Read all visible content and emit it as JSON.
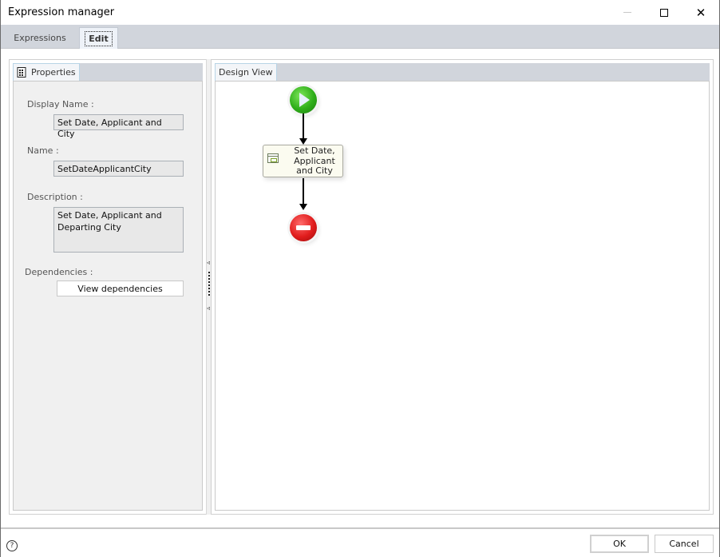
{
  "window": {
    "title": "Expression manager",
    "controls": {
      "minimize": "minimize-icon",
      "maximize": "maximize-icon",
      "close": "close-icon",
      "close_glyph": "✕"
    }
  },
  "tabs": [
    {
      "label": "Expressions",
      "active": false
    },
    {
      "label": "Edit",
      "active": true
    }
  ],
  "properties_panel": {
    "tab_label": "Properties",
    "tab_icon": "property-grid-icon",
    "display_name_label": "Display Name :",
    "display_name_value": "Set Date, Applicant and City",
    "name_label": "Name :",
    "name_value": "SetDateApplicantCity",
    "description_label": "Description :",
    "description_value": "Set Date, Applicant and Departing City",
    "dependencies_label": "Dependencies :",
    "view_dependencies_button": "View dependencies"
  },
  "splitter": {
    "arrow_glyph": "◃"
  },
  "design_view": {
    "tab_label": "Design View",
    "nodes": [
      {
        "type": "start",
        "icon": "start-play-icon"
      },
      {
        "type": "task",
        "label": "Set Date, Applicant and City",
        "icon": "expression-task-icon"
      },
      {
        "type": "end",
        "icon": "stop-icon"
      }
    ]
  },
  "footer": {
    "help_glyph": "?",
    "ok_label": "OK",
    "cancel_label": "Cancel"
  }
}
